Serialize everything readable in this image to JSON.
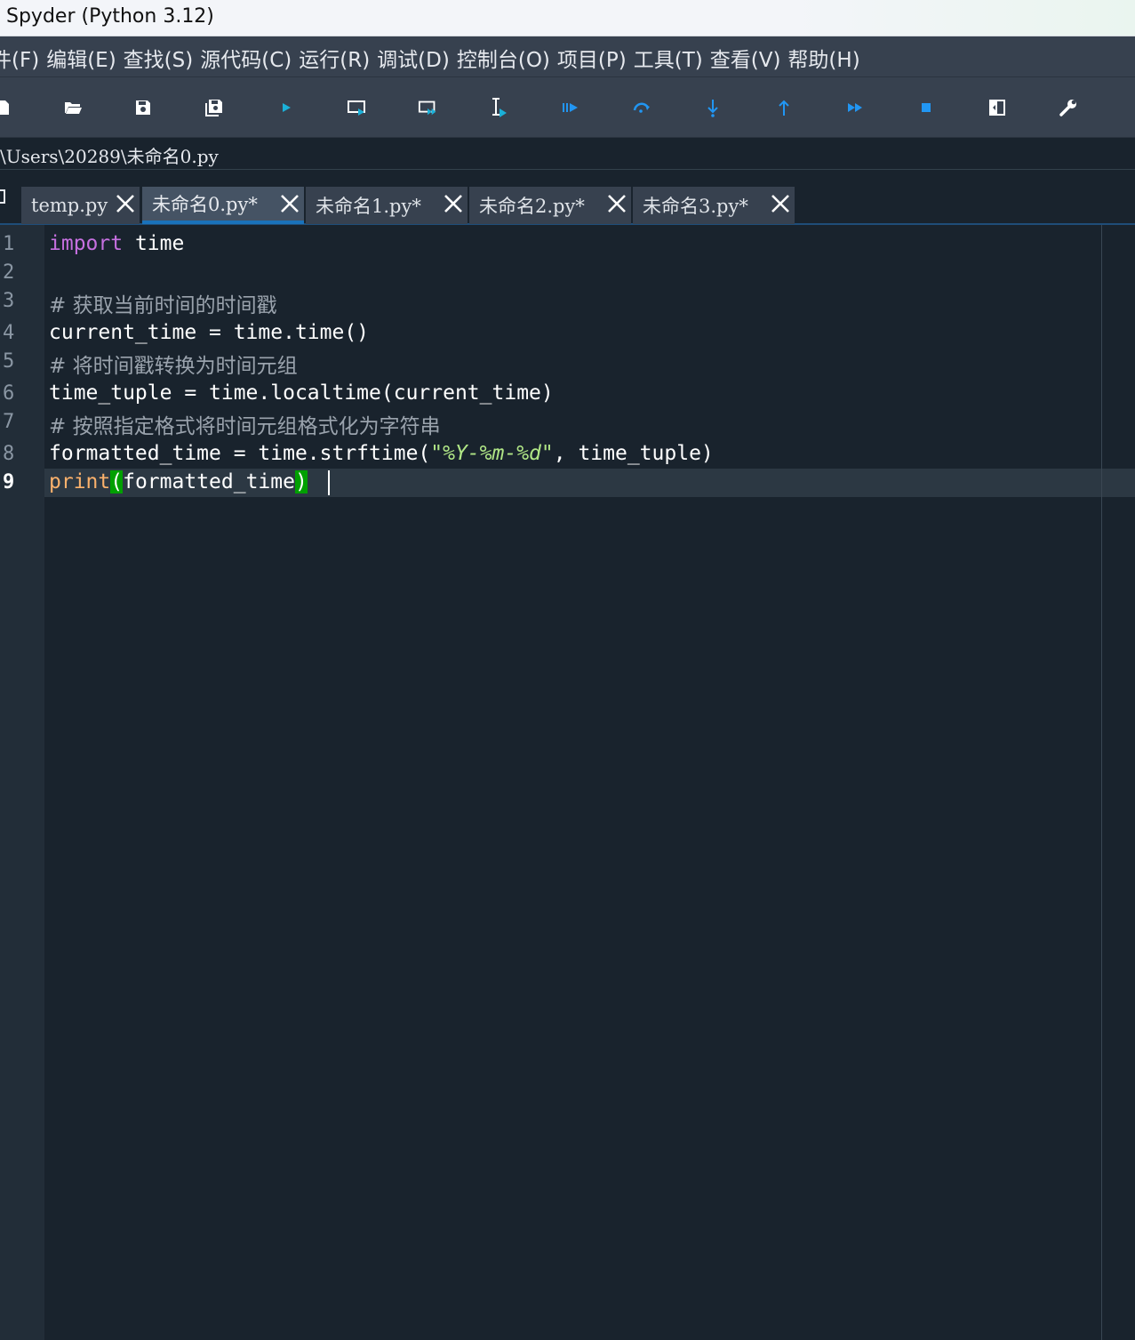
{
  "window": {
    "title": "Spyder (Python 3.12)"
  },
  "menubar": {
    "items": [
      "件(F)",
      "编辑(E)",
      "查找(S)",
      "源代码(C)",
      "运行(R)",
      "调试(D)",
      "控制台(O)",
      "项目(P)",
      "工具(T)",
      "查看(V)",
      "帮助(H)"
    ]
  },
  "toolbar": {
    "icons": [
      "new-file-icon",
      "open-folder-icon",
      "save-icon",
      "save-all-icon",
      "run-icon",
      "run-cell-icon",
      "run-cell-advance-icon",
      "run-selection-icon",
      "debug-icon",
      "step-over-icon",
      "step-into-icon",
      "step-return-icon",
      "continue-icon",
      "stop-icon",
      "maximize-pane-icon",
      "preferences-icon"
    ],
    "accent": "#2196f3",
    "run_color": "#1bb0d8"
  },
  "path": {
    "current_file": "\\Users\\20289\\未命名0.py"
  },
  "tabs": [
    {
      "label": "temp.py",
      "active": false
    },
    {
      "label": "未命名0.py*",
      "active": true
    },
    {
      "label": "未命名1.py*",
      "active": false
    },
    {
      "label": "未命名2.py*",
      "active": false
    },
    {
      "label": "未命名3.py*",
      "active": false
    }
  ],
  "editor": {
    "current_line": 9,
    "line_numbers": [
      "1",
      "2",
      "3",
      "4",
      "5",
      "6",
      "7",
      "8",
      "9"
    ],
    "lines": {
      "l1_kw": "import",
      "l1_rest": " time",
      "l3": "# 获取当前时间的时间戳",
      "l4": "current_time = time.time()",
      "l5": "# 将时间戳转换为时间元组",
      "l6": "time_tuple = time.localtime(current_time)",
      "l7": "# 按照指定格式将时间元组格式化为字符串",
      "l8_a": "formatted_time = time.strftime(",
      "l8_str": "\"%Y-%m-%d\"",
      "l8_b": ", time_tuple)",
      "l9_fn": "print",
      "l9_open": "(",
      "l9_arg": "formatted_time",
      "l9_close": ")"
    }
  }
}
